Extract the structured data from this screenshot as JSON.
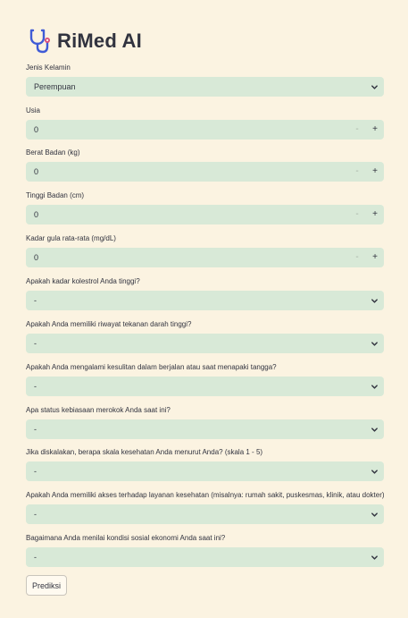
{
  "app": {
    "title": "RiMed AI",
    "logo_icon": "stethoscope-icon"
  },
  "colors": {
    "background": "#fbf3e1",
    "input_bg": "#d8e9d7",
    "text": "#31333f",
    "logo_primary": "#3f5bd6",
    "logo_accent": "#d94b79"
  },
  "form": {
    "gender": {
      "label": "Jenis Kelamin",
      "value": "Perempuan"
    },
    "age": {
      "label": "Usia",
      "value": "0",
      "decrement": "-",
      "increment": "+"
    },
    "weight": {
      "label": "Berat Badan (kg)",
      "value": "0",
      "decrement": "-",
      "increment": "+"
    },
    "height": {
      "label": "Tinggi Badan (cm)",
      "value": "0",
      "decrement": "-",
      "increment": "+"
    },
    "glucose": {
      "label": "Kadar gula rata-rata (mg/dL)",
      "value": "0",
      "decrement": "-",
      "increment": "+"
    },
    "cholesterol": {
      "label": "Apakah kadar kolestrol Anda tinggi?",
      "value": "-"
    },
    "hypertension": {
      "label": "Apakah Anda memiliki riwayat tekanan darah tinggi?",
      "value": "-"
    },
    "walking": {
      "label": "Apakah Anda mengalami kesulitan dalam berjalan atau saat menapaki tangga?",
      "value": "-"
    },
    "smoking": {
      "label": "Apa status kebiasaan merokok Anda saat ini?",
      "value": "-"
    },
    "health_scale": {
      "label": "Jika diskalakan, berapa skala kesehatan Anda menurut Anda? (skala 1 - 5)",
      "value": "-"
    },
    "healthcare_access": {
      "label": "Apakah Anda memiliki akses terhadap layanan kesehatan (misalnya: rumah sakit, puskesmas, klinik, atau dokter)?",
      "value": "-"
    },
    "socioeconomic": {
      "label": "Bagaimana Anda menilai kondisi sosial ekonomi Anda saat ini?",
      "value": "-"
    }
  },
  "submit": {
    "label": "Prediksi"
  }
}
